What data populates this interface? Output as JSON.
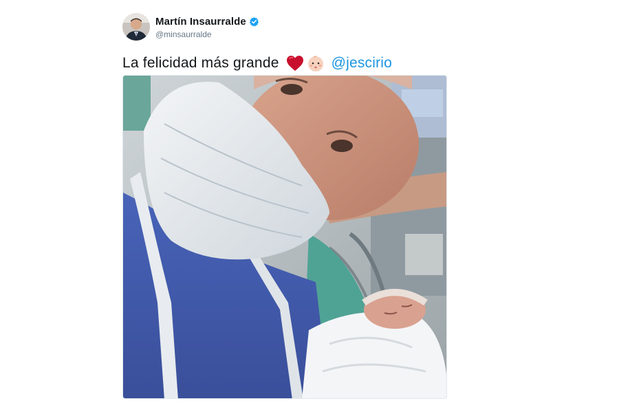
{
  "tweet": {
    "author": {
      "display_name": "Martín Insaurralde",
      "handle": "@minsaurralde",
      "verified": true,
      "avatar_icon": "avatar-photo"
    },
    "text": {
      "body": "La felicidad más grande",
      "emojis": [
        "heart-icon",
        "baby-icon"
      ],
      "mention": "@jescirio"
    },
    "media": {
      "type": "photo",
      "description_icon": "selfie-photo"
    },
    "colors": {
      "link": "#1b95e0",
      "verified_badge": "#1da1f2",
      "heart": "#e0245e"
    }
  }
}
